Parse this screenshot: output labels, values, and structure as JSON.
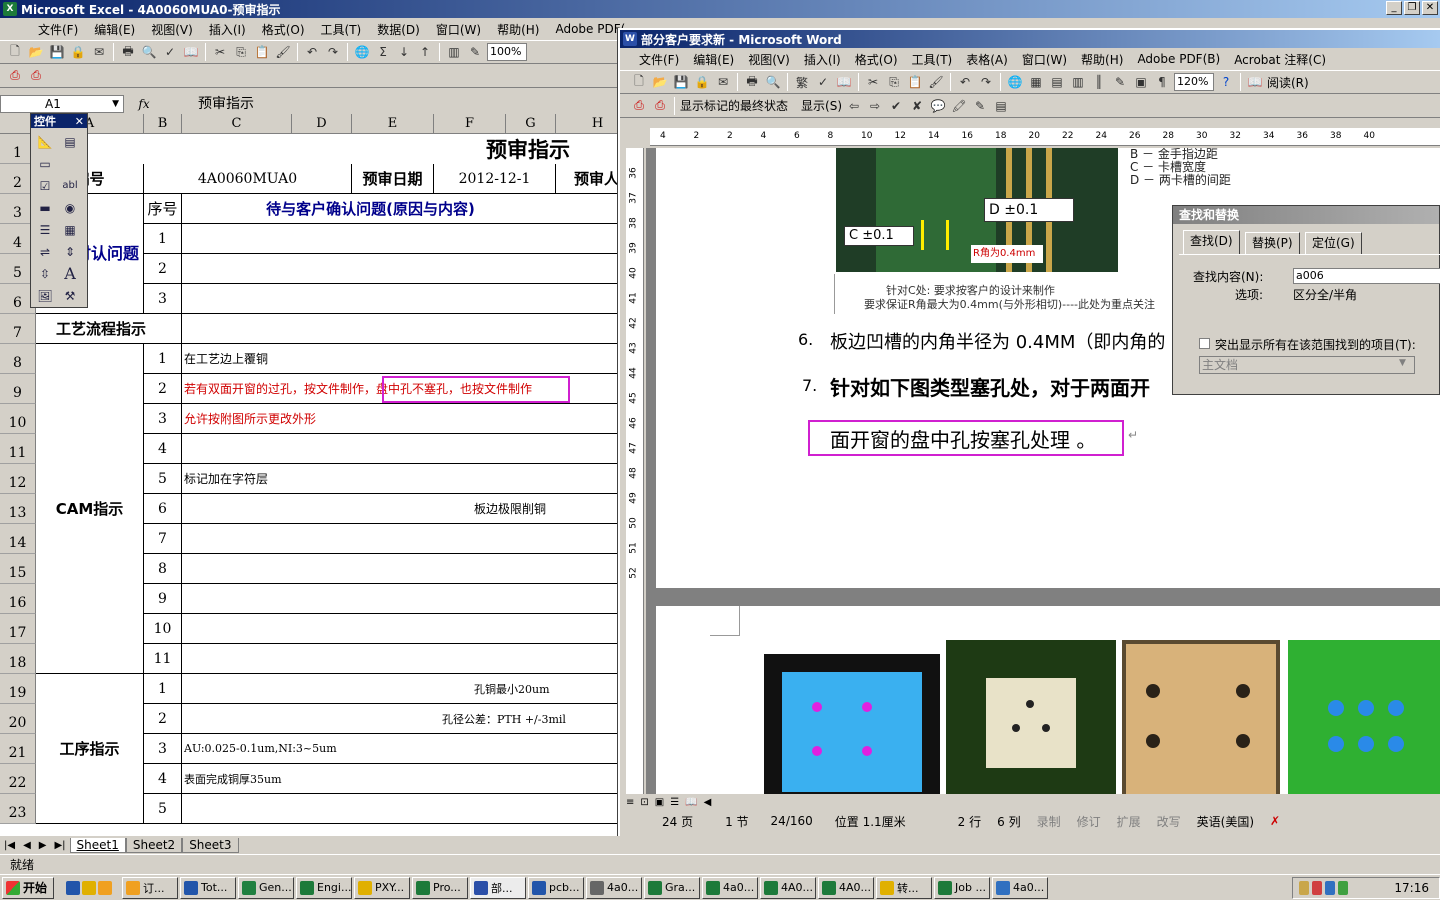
{
  "excel": {
    "title": "Microsoft Excel - 4A0060MUA0-预审指示",
    "menu": [
      "文件(F)",
      "编辑(E)",
      "视图(V)",
      "插入(I)",
      "格式(O)",
      "工具(T)",
      "数据(D)",
      "窗口(W)",
      "帮助(H)",
      "Adobe PDF("
    ],
    "zoom": "100%",
    "namebox": "A1",
    "fx": "fx",
    "formula": "预审指示",
    "palette_title": "控件",
    "columns": [
      "A",
      "B",
      "C",
      "D",
      "E",
      "F",
      "G",
      "H"
    ],
    "rows": [
      "1",
      "2",
      "3",
      "4",
      "5",
      "6",
      "7",
      "8",
      "9",
      "10",
      "11",
      "12",
      "13",
      "14",
      "15",
      "16",
      "17",
      "18",
      "19",
      "20",
      "21",
      "22",
      "23"
    ],
    "sheet": {
      "title": "预审指示",
      "label_no": "编号",
      "part_no": "4A0060MUA0",
      "label_date": "预审日期",
      "date": "2012-12-1",
      "label_reviewer": "预审人",
      "label_seq": "序号",
      "confirm_header": "待与客户确认问题(原因与内容)",
      "section_photo": "光绘时认问题",
      "section_process": "工艺流程指示",
      "section_cam": "CAM指示",
      "section_op": "工序指示",
      "photo_rows": [
        "1",
        "2",
        "3"
      ],
      "cam_rows": [
        {
          "n": "1",
          "text": "在工艺边上覆铜",
          "color": "#000000"
        },
        {
          "n": "2",
          "text": "若有双面开窗的过孔，按文件制作，盘中孔不塞孔，也按文件制作",
          "color": "#d00000"
        },
        {
          "n": "3",
          "text": "允许按附图所示更改外形",
          "color": "#d00000"
        },
        {
          "n": "4",
          "text": "",
          "color": "#000000"
        },
        {
          "n": "5",
          "text": "标记加在字符层",
          "color": "#000000"
        },
        {
          "n": "6",
          "text": "板边极限削铜",
          "color": "#000000"
        },
        {
          "n": "7",
          "text": "",
          "color": "#000000"
        },
        {
          "n": "8",
          "text": "",
          "color": "#000000"
        },
        {
          "n": "9",
          "text": "",
          "color": "#000000"
        },
        {
          "n": "10",
          "text": "",
          "color": "#000000"
        },
        {
          "n": "11",
          "text": "",
          "color": "#000000"
        }
      ],
      "op_rows": [
        {
          "n": "1",
          "text": "孔铜最小20um"
        },
        {
          "n": "2",
          "text": "孔径公差：PTH +/-3mil"
        },
        {
          "n": "3",
          "text": "AU:0.025-0.1um,NI:3~5um"
        },
        {
          "n": "4",
          "text": "表面完成铜厚35um"
        },
        {
          "n": "5",
          "text": ""
        }
      ]
    },
    "sheet_tabs": [
      "Sheet1",
      "Sheet2",
      "Sheet3"
    ],
    "status": "就绪"
  },
  "word": {
    "title": "部分客户要求新 - Microsoft Word",
    "menu": [
      "文件(F)",
      "编辑(E)",
      "视图(V)",
      "插入(I)",
      "格式(O)",
      "工具(T)",
      "表格(A)",
      "窗口(W)",
      "帮助(H)",
      "Adobe PDF(B)",
      "Acrobat 注释(C)"
    ],
    "zoom": "120%",
    "read_button": "阅读(R)",
    "markup_select": "显示标记的最终状态",
    "show_menu": "显示(S)",
    "ruler_numbers": [
      "4",
      "2",
      "2",
      "4",
      "6",
      "8",
      "10",
      "12",
      "14",
      "16",
      "18",
      "20",
      "22",
      "24",
      "26",
      "28",
      "30",
      "32",
      "34",
      "36",
      "38",
      "40"
    ],
    "vruler_numbers": [
      "36",
      "37",
      "38",
      "39",
      "40",
      "41",
      "42",
      "43",
      "44",
      "45",
      "46",
      "47",
      "48",
      "49",
      "50",
      "51",
      "52"
    ],
    "figure_legend": [
      "B － 金手指边距",
      "C － 卡槽宽度",
      "D －  两卡槽的间距"
    ],
    "figure_d": "D ±0.1",
    "figure_c": "C ±0.1",
    "figure_r": "R角为0.4mm",
    "figure_caption1": "针对C处: 要求按客户的设计来制作",
    "figure_caption2": "要求保证R角最大为0.4mm(与外形相切)----此处为重点关注",
    "item6_num": "6.",
    "item6_text": "板边凹槽的内角半径为 0.4MM（即内角的",
    "item7_num": "7.",
    "item7_text": "针对如下图类型塞孔处，对于两面开",
    "item7_cont": "面开窗的盘中孔按塞孔处理 。",
    "status": {
      "page": "24 页",
      "section": "1 节",
      "pages": "24/160",
      "position": "位置 1.1厘米",
      "line": "2 行",
      "col": "6 列",
      "rec": "录制",
      "trk": "修订",
      "ext": "扩展",
      "ovr": "改写",
      "lang": "英语(美国)"
    }
  },
  "find": {
    "title": "查找和替换",
    "tabs": [
      "查找(D)",
      "替换(P)",
      "定位(G)"
    ],
    "label_find": "查找内容(N):",
    "value": "a006",
    "label_options": "选项:",
    "options_value": "区分全/半角",
    "checkbox_label": "突出显示所有在该范围找到的项目(T):",
    "scope": "主文档"
  },
  "taskbar": {
    "start": "开始",
    "buttons": [
      "订...",
      "Tot...",
      "Gen...",
      "Engi...",
      "PXY...",
      "Pro...",
      "部...",
      "pcb...",
      "4a0...",
      "Gra...",
      "4a0...",
      "4A0...",
      "4A0...",
      "转...",
      "Job ...",
      "4a0..."
    ],
    "time": "17:16"
  },
  "colors": {
    "accent": "#0a246a",
    "highlight": "#d020d0",
    "red_text": "#d00000",
    "blue_text": "#00008b"
  }
}
